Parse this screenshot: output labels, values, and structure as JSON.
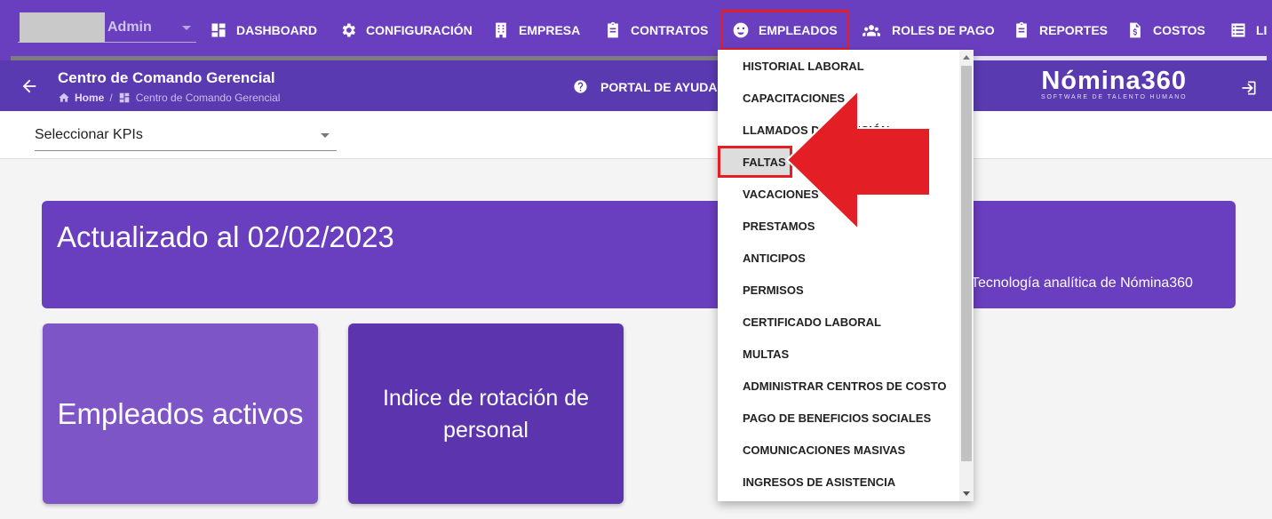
{
  "user": {
    "name": "Admin"
  },
  "nav": [
    {
      "label": "DASHBOARD",
      "icon": "dashboard-icon"
    },
    {
      "label": "CONFIGURACIÓN",
      "icon": "gear-icon"
    },
    {
      "label": "EMPRESA",
      "icon": "building-icon"
    },
    {
      "label": "CONTRATOS",
      "icon": "clipboard-icon"
    },
    {
      "label": "EMPLEADOS",
      "icon": "employee-face-icon"
    },
    {
      "label": "ROLES DE PAGO",
      "icon": "group-icon"
    },
    {
      "label": "REPORTES",
      "icon": "clipboard-icon"
    },
    {
      "label": "COSTOS",
      "icon": "money-file-icon"
    },
    {
      "label": "LI",
      "icon": "list-icon"
    }
  ],
  "subheader": {
    "title": "Centro de Comando Gerencial",
    "breadcrumb_home": "Home",
    "breadcrumb_current": "Centro de Comando Gerencial",
    "help_label": "PORTAL DE AYUDA",
    "brand_name": "Nómina360",
    "brand_tagline": "SOFTWARE DE TALENTO HUMANO"
  },
  "kpi_select": {
    "label": "Seleccionar KPIs"
  },
  "banner": {
    "title": "Actualizado al 02/02/2023",
    "caption": "Tecnología analítica de Nómina360"
  },
  "cards": [
    {
      "label": "Empleados activos"
    },
    {
      "label": "Indice de rotación de personal"
    }
  ],
  "dropdown": {
    "items": [
      "HISTORIAL LABORAL",
      "CAPACITACIONES",
      "LLAMADOS DE ATENCIÓN",
      "FALTAS",
      "VACACIONES",
      "PRESTAMOS",
      "ANTICIPOS",
      "PERMISOS",
      "CERTIFICADO LABORAL",
      "MULTAS",
      "ADMINISTRAR CENTROS DE COSTO",
      "PAGO DE BENEFICIOS SOCIALES",
      "COMUNICACIONES MASIVAS",
      "INGRESOS DE ASISTENCIA"
    ],
    "selected_index": 3
  },
  "colors": {
    "primary": "#6a3fbf",
    "subheader": "#5a3ab1",
    "highlight": "#e31e24"
  }
}
